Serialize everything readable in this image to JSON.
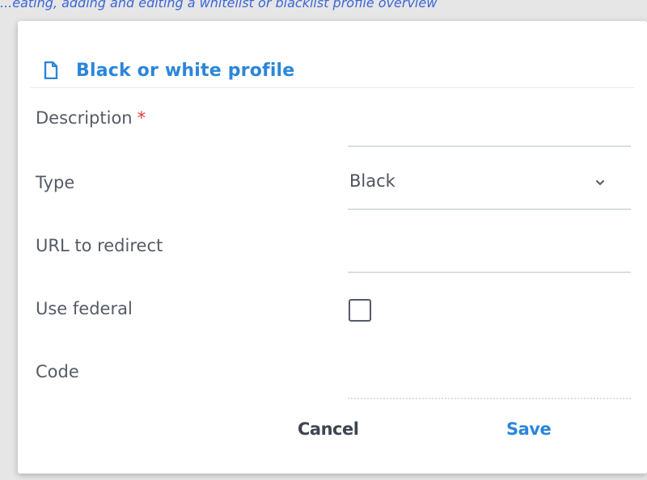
{
  "background_text": "...eating, adding and editing a whitelist or blacklist profile overview",
  "dialog": {
    "title": "Black or white profile",
    "fields": {
      "description": {
        "label": "Description",
        "required_mark": "*",
        "value": ""
      },
      "type": {
        "label": "Type",
        "value": "Black"
      },
      "url": {
        "label": "URL to redirect",
        "value": ""
      },
      "federal": {
        "label": "Use federal",
        "checked": false
      },
      "code": {
        "label": "Code",
        "value": ""
      }
    },
    "buttons": {
      "cancel": "Cancel",
      "save": "Save"
    }
  },
  "colors": {
    "accent": "#2b86d9",
    "required": "#e03b3b",
    "text": "#555a66"
  },
  "icons": {
    "header": "document-icon",
    "type_dropdown": "chevron-down-icon"
  }
}
